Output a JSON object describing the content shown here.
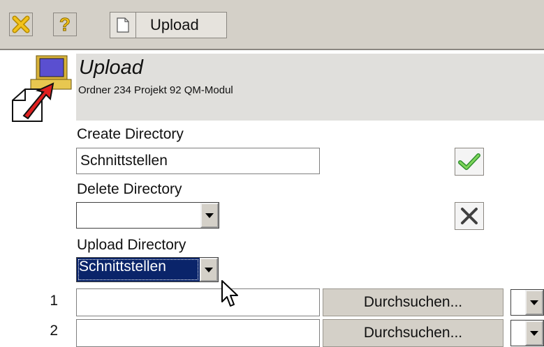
{
  "toolbar": {
    "close_icon": "close-x-icon",
    "help_icon": "help-question-icon",
    "tab_label": "Upload",
    "tab_icon": "document-icon"
  },
  "header": {
    "icon": "upload-computer-icon",
    "title": "Upload",
    "subtitle": "Ordner 234 Projekt 92 QM-Modul"
  },
  "form": {
    "create_label": "Create Directory",
    "create_value": "Schnittstellen",
    "create_confirm_icon": "checkmark-icon",
    "delete_label": "Delete Directory",
    "delete_value": "",
    "delete_icon": "delete-x-icon",
    "upload_dir_label": "Upload Directory",
    "upload_dir_value": "Schnittstellen"
  },
  "uploads": [
    {
      "num": "1",
      "value": "",
      "browse": "Durchsuchen..."
    },
    {
      "num": "2",
      "value": "",
      "browse": "Durchsuchen..."
    }
  ],
  "colors": {
    "toolbar_bg": "#d4d0c8",
    "header_band": "#e0dfdc",
    "selection": "#0a246a",
    "check_green": "#3aa63a"
  }
}
